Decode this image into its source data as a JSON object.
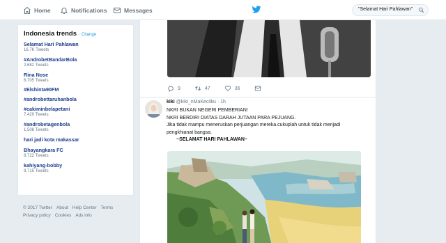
{
  "nav": {
    "home": "Home",
    "notifications": "Notifications",
    "messages": "Messages",
    "search_value": "\"Selamat Hari Pahlawan\""
  },
  "trends": {
    "title": "Indonesia trends",
    "separator": "·",
    "change": "Change",
    "items": [
      {
        "name": "Selamat Hari Pahlawan",
        "count": "16.7K Tweets"
      },
      {
        "name": "#AndrobetBandarBola",
        "count": "2,682 Tweets"
      },
      {
        "name": "Rina Nose",
        "count": "6,705 Tweets"
      },
      {
        "name": "#Elshinta90FM",
        "count": ""
      },
      {
        "name": "#androbettaruhanbola",
        "count": ""
      },
      {
        "name": "#cakiminbelapetani",
        "count": "7,429 Tweets"
      },
      {
        "name": "#androbetagenbola",
        "count": "1,508 Tweets"
      },
      {
        "name": "hari jadi kota makassar",
        "count": ""
      },
      {
        "name": "Bhayangkara FC",
        "count": "8,722 Tweets"
      },
      {
        "name": "kahiyang-bobby",
        "count": "9,715 Tweets"
      }
    ]
  },
  "footer": {
    "copyright": "© 2017 Twitter",
    "about": "About",
    "help": "Help Center",
    "terms": "Terms",
    "privacy": "Privacy policy",
    "cookies": "Cookies",
    "ads": "Ads info"
  },
  "prev_tweet": {
    "replies": "9",
    "retweets": "47",
    "likes": "36"
  },
  "tweet": {
    "name": "kiki",
    "handle": "@kiki_nMaKecilku",
    "time": "· 1h",
    "lines": [
      "NKRI BUKAN NEGERI PEMBERIAN!",
      "NKRI BERDIRI DIATAS DARAH JUTAAN PARA PEJUANG.",
      "Jika tidak mampu meneruskan perjuangan mereka.cukuplah untuk tidak menjadi",
      "pengkhianat bangsa."
    ],
    "closing": "~SELAMAT HARI PAHLAWAN~"
  },
  "colors": {
    "accent": "#1da1f2",
    "trend_link": "#1c3c8c",
    "background": "#e6ecf0"
  }
}
